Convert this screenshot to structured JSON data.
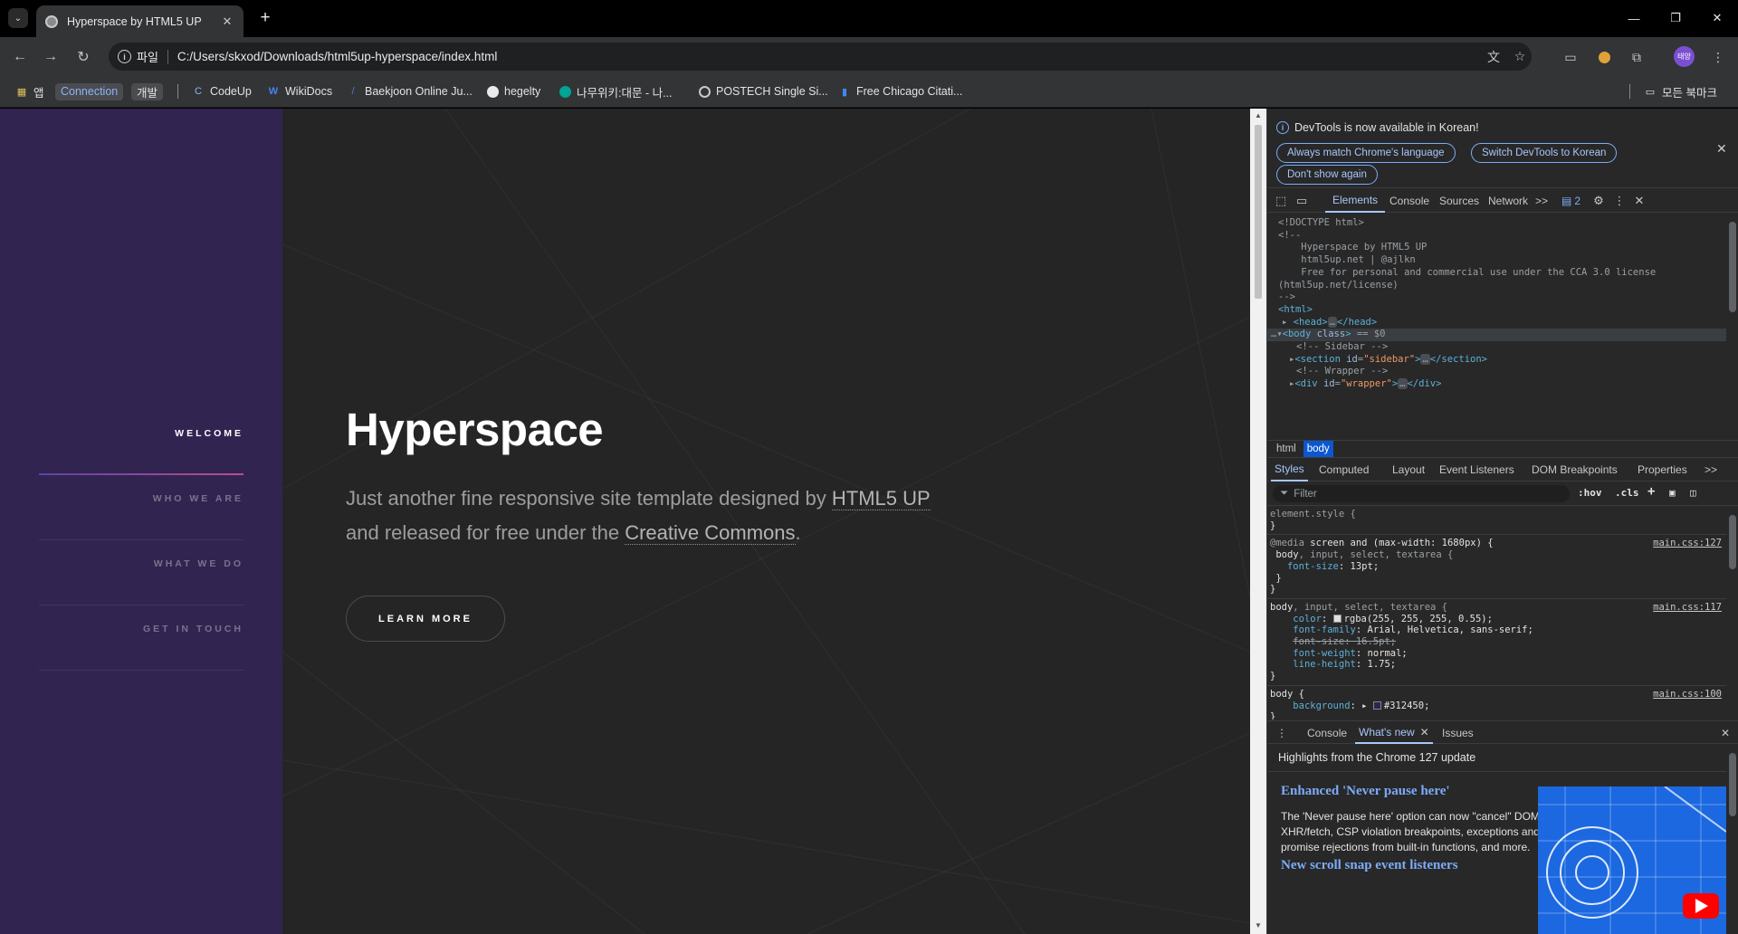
{
  "browser": {
    "tab_title": "Hyperspace by HTML5 UP",
    "url_scheme": "파일",
    "url": "C:/Users/skxod/Downloads/html5up-hyperspace/index.html",
    "profile_label": "태양"
  },
  "bookmarks": [
    {
      "label": "앱",
      "icon": "apps-grid-icon"
    },
    {
      "label": "Connection",
      "icon": "",
      "chip": true,
      "color": "#8ab4f8"
    },
    {
      "label": "개발",
      "icon": "",
      "chip": true
    },
    {
      "label": "CodeUp",
      "icon": "codeup-icon"
    },
    {
      "label": "WikiDocs",
      "icon": "wikidocs-icon"
    },
    {
      "label": "Baekjoon Online Ju...",
      "icon": "baekjoon-icon"
    },
    {
      "label": "hegelty",
      "icon": "github-icon"
    },
    {
      "label": "나무위키:대문 - 나...",
      "icon": "namuwiki-icon"
    },
    {
      "label": "POSTECH Single Si...",
      "icon": "globe-icon"
    },
    {
      "label": "Free Chicago Citati...",
      "icon": "bookmark-icon"
    }
  ],
  "all_bookmarks_label": "모든 북마크",
  "site": {
    "nav": [
      {
        "label": "WELCOME",
        "active": true
      },
      {
        "label": "WHO WE ARE",
        "active": false
      },
      {
        "label": "WHAT WE DO",
        "active": false
      },
      {
        "label": "GET IN TOUCH",
        "active": false
      }
    ],
    "title": "Hyperspace",
    "intro_1": "Just another fine responsive site template designed by ",
    "intro_link_1": "HTML5 UP",
    "intro_2": "and released for free under the ",
    "intro_link_2": "Creative Commons",
    "intro_3": ".",
    "button": "LEARN MORE",
    "colors": {
      "sidebar": "#312450",
      "main": "#252525"
    }
  },
  "devtools": {
    "info": "DevTools is now available in Korean!",
    "btn_match": "Always match Chrome's language",
    "btn_switch": "Switch DevTools to Korean",
    "btn_dont": "Don't show again",
    "tabs": [
      "Elements",
      "Console",
      "Sources",
      "Network"
    ],
    "more_tabs": ">>",
    "issues_count": "2",
    "dom": {
      "l1": "<!DOCTYPE html>",
      "l2": "<!--",
      "l3": "    Hyperspace by HTML5 UP",
      "l4": "    html5up.net | @ajlkn",
      "l5": "    Free for personal and commercial use under the CCA 3.0 license",
      "l6": "(html5up.net/license)",
      "l7": "-->",
      "l8": "<html>",
      "l9_open": "<head>",
      "l9_close": "</head>",
      "l10_tag": "<body",
      "l10_attr": "class",
      "l10_end": ">",
      "l10_ref": "== $0",
      "l11": "<!-- Sidebar -->",
      "l12_tag": "<section",
      "l12_attr": "id",
      "l12_val": "\"sidebar\"",
      "l12_close": "</section>",
      "l13": "<!-- Wrapper -->",
      "l14_tag": "<div",
      "l14_attr": "id",
      "l14_val": "\"wrapper\"",
      "l14_close": "</div>"
    },
    "breadcrumbs": [
      "html",
      "body"
    ],
    "style_tabs": [
      "Styles",
      "Computed",
      "Layout",
      "Event Listeners",
      "DOM Breakpoints",
      "Properties"
    ],
    "filter_placeholder": "Filter",
    "hov": ":hov",
    "cls": ".cls",
    "rules": {
      "r1_sel": "element.style {",
      "r2_media_kw": "@media",
      "r2_media": " screen and (max-width: 1680px) {",
      "r2_sel_main": "body",
      "r2_sel_rest": ", input, select, textarea {",
      "r2_prop": "font-size",
      "r2_val": "13pt;",
      "r2_src": "main.css:127",
      "r3_sel_main": "body",
      "r3_sel_rest": ", input, select, textarea {",
      "r3_src": "main.css:117",
      "r3_p1": "color",
      "r3_v1": "rgba(255, 255, 255, 0.55);",
      "r3_p2": "font-family",
      "r3_v2": "Arial, Helvetica, sans-serif;",
      "r3_p3": "font-size: 16.5pt;",
      "r3_p4": "font-weight",
      "r3_v4": "normal;",
      "r3_p5": "line-height",
      "r3_v5": "1.75;",
      "r4_sel": "body {",
      "r4_src": "main.css:100",
      "r4_p1": "background",
      "r4_v1": "#312450;",
      "close": "}"
    },
    "drawer_tabs": [
      "Console",
      "What's new",
      "Issues"
    ],
    "whatsnew": {
      "header": "Highlights from the Chrome 127 update",
      "h1": "Enhanced 'Never pause here'",
      "body": "The 'Never pause here' option can now \"cancel\" DOM, XHR/fetch, CSP violation breakpoints, exceptions and promise rejections from built-in functions, and more.",
      "h2": "New scroll snap event listeners"
    }
  }
}
